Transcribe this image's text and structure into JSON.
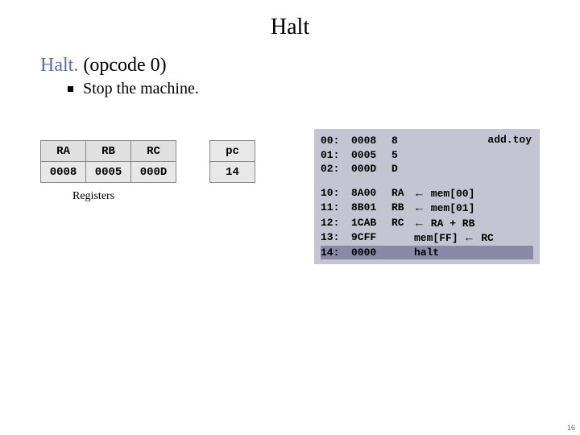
{
  "title": "Halt",
  "subtitle_part1": "Halt.",
  "subtitle_part2": "  (opcode  0)",
  "bullet_text": "Stop the machine.",
  "registers": {
    "headers": [
      "RA",
      "RB",
      "RC"
    ],
    "values": [
      "0008",
      "0005",
      "000D"
    ],
    "caption": "Registers"
  },
  "pc": {
    "header": "pc",
    "value": "14"
  },
  "code": {
    "program_name": "add.toy",
    "block1": [
      {
        "addr": "00:",
        "hex": "0008",
        "opd": "8",
        "cmt": ""
      },
      {
        "addr": "01:",
        "hex": "0005",
        "opd": "5",
        "cmt": ""
      },
      {
        "addr": "02:",
        "hex": "000D",
        "opd": "D",
        "cmt": ""
      }
    ],
    "block2": [
      {
        "addr": "10:",
        "hex": "8A00",
        "opd": "RA",
        "cmt_pre": "",
        "cmt_arrow": true,
        "cmt_post": " mem[00]"
      },
      {
        "addr": "11:",
        "hex": "8B01",
        "opd": "RB",
        "cmt_pre": "",
        "cmt_arrow": true,
        "cmt_post": " mem[01]"
      },
      {
        "addr": "12:",
        "hex": "1CAB",
        "opd": "RC",
        "cmt_pre": "",
        "cmt_arrow": true,
        "cmt_post": " RA + RB"
      },
      {
        "addr": "13:",
        "hex": "9CFF",
        "opd": "",
        "cmt_pre": "mem[FF] ",
        "cmt_arrow": true,
        "cmt_post": " RC"
      },
      {
        "addr": "14:",
        "hex": "0000",
        "opd": "",
        "cmt_pre": "halt",
        "cmt_arrow": false,
        "cmt_post": "",
        "highlight": true
      }
    ]
  },
  "page_number": "16"
}
